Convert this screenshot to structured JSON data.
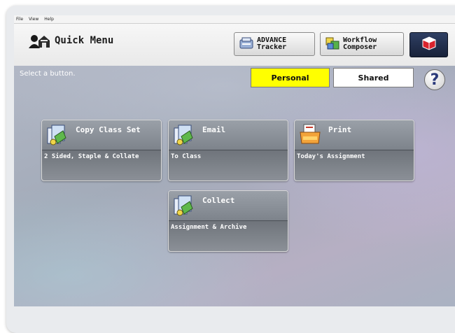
{
  "menubar": {
    "items": [
      "File",
      "View",
      "Help"
    ]
  },
  "header": {
    "title": "Quick Menu",
    "advance": {
      "line1": "ADVANCE",
      "line2": "Tracker"
    },
    "workflow": {
      "line1": "Workflow",
      "line2": "Composer"
    }
  },
  "main": {
    "instruction": "Select a button.",
    "toggle_personal": "Personal",
    "toggle_shared": "Shared",
    "help_symbol": "?",
    "tiles": [
      {
        "label": "Copy Class Set",
        "sub": "2 Sided, Staple & Collate",
        "icon": "copy-icon"
      },
      {
        "label": "Email",
        "sub": "To Class",
        "icon": "email-icon"
      },
      {
        "label": "Print",
        "sub": "Today's Assignment",
        "icon": "print-icon"
      },
      {
        "label": "Collect",
        "sub": "Assignment & Archive",
        "icon": "collect-icon"
      }
    ]
  },
  "colors": {
    "selected_toggle": "#ffff00",
    "tile_text": "#ffffff",
    "red_logo": "#d9232d"
  }
}
